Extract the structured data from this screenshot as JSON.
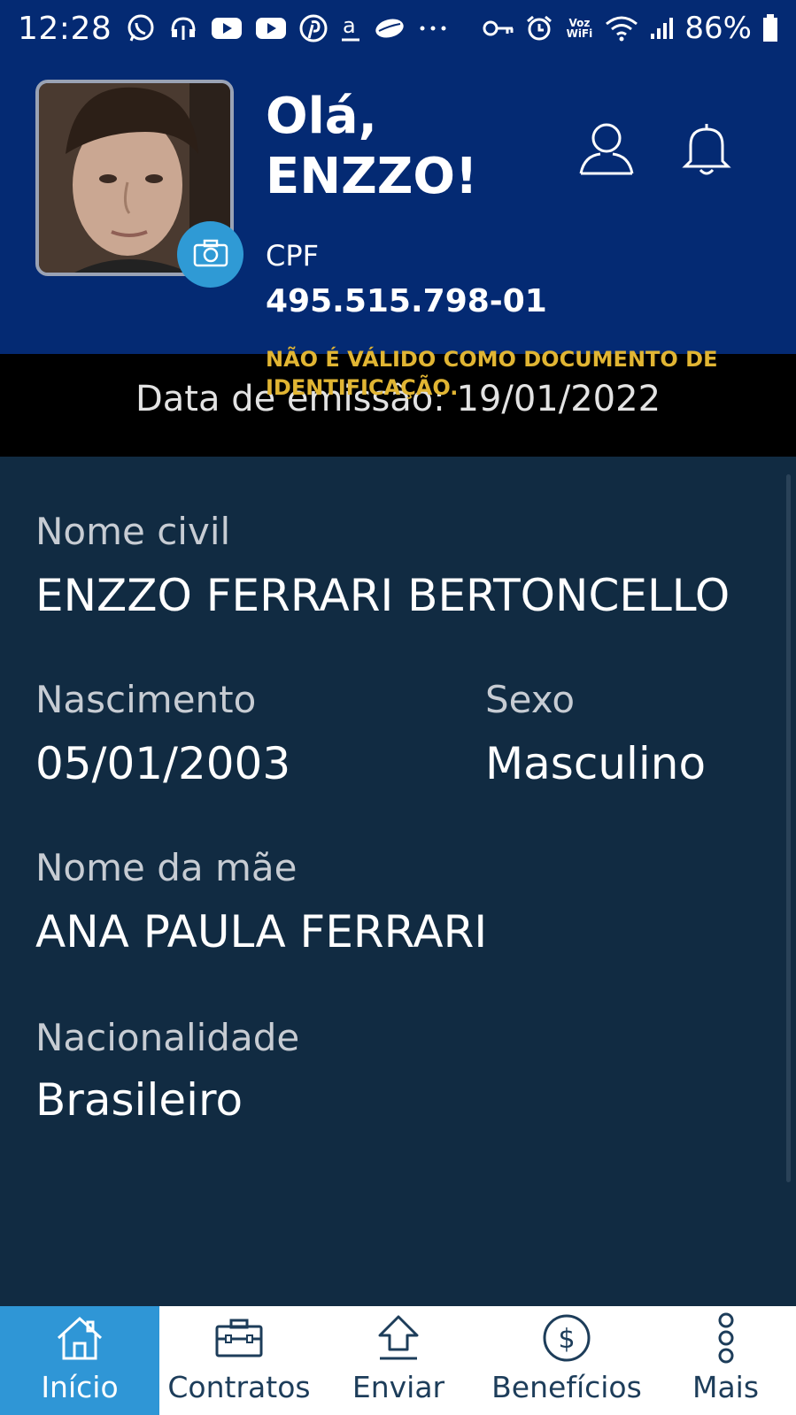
{
  "status_bar": {
    "time": "12:28",
    "left_icons": [
      "whatsapp-icon",
      "headset-icon",
      "youtube-icon",
      "youtube-icon",
      "pinterest-icon",
      "amazon-icon",
      "app-icon",
      "more-dots-icon"
    ],
    "voz_wifi": "Voz WiFi",
    "battery_pct": "86%"
  },
  "header": {
    "greeting": "Olá,",
    "name": "ENZZO!",
    "cpf_label": "CPF",
    "cpf_value": "495.515.798-01",
    "warning": "NÃO É VÁLIDO COMO DOCUMENTO DE IDENTIFICAÇÃO.",
    "colors": {
      "header_bg": "#042a73",
      "camera_button": "#2f9ad5",
      "warning": "#e1b533"
    }
  },
  "emission": {
    "text": "Data de emissão: 19/01/2022"
  },
  "details": {
    "civil_name_label": "Nome civil",
    "civil_name": "ENZZO FERRARI BERTONCELLO",
    "birth_label": "Nascimento",
    "birth": "05/01/2003",
    "sex_label": "Sexo",
    "sex": "Masculino",
    "mother_label": "Nome da mãe",
    "mother": "ANA PAULA FERRARI",
    "nationality_label": "Nacionalidade",
    "nationality": "Brasileiro"
  },
  "nav": {
    "items": [
      {
        "label": "Início",
        "icon": "home-icon",
        "active": true
      },
      {
        "label": "Contratos",
        "icon": "briefcase-icon",
        "active": false
      },
      {
        "label": "Enviar",
        "icon": "upload-icon",
        "active": false
      },
      {
        "label": "Benefícios",
        "icon": "dollar-icon",
        "active": false
      },
      {
        "label": "Mais",
        "icon": "more-vertical-icon",
        "active": false
      }
    ],
    "active_color": "#2f96d6"
  }
}
